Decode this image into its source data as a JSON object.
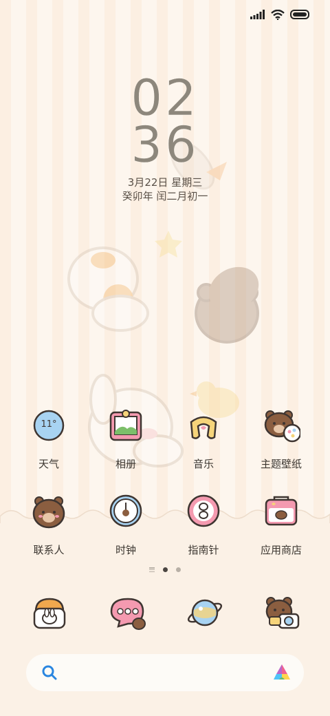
{
  "status_bar": {
    "icons": [
      "signal-icon",
      "wifi-icon",
      "battery-icon"
    ]
  },
  "lock_clock": {
    "hours": "02",
    "minutes": "36",
    "date": "3月22日 星期三",
    "lunar_date": "癸卯年 闰二月初一"
  },
  "apps": [
    {
      "label": "天气",
      "icon": "weather-icon",
      "badge": "11°"
    },
    {
      "label": "相册",
      "icon": "gallery-icon"
    },
    {
      "label": "音乐",
      "icon": "music-icon"
    },
    {
      "label": "主题壁纸",
      "icon": "themes-icon"
    },
    {
      "label": "联系人",
      "icon": "contacts-icon"
    },
    {
      "label": "时钟",
      "icon": "clock-icon"
    },
    {
      "label": "指南针",
      "icon": "compass-icon"
    },
    {
      "label": "应用商店",
      "icon": "app-store-icon"
    }
  ],
  "page_indicator": {
    "pages": 2,
    "active": 1
  },
  "dock": [
    "phone-icon",
    "messages-icon",
    "browser-icon",
    "camera-icon"
  ],
  "search_bar": {
    "icon": "search-icon",
    "assistant_icon": "app-launcher-icon"
  },
  "colors": {
    "background": "#fbf1e6",
    "stripe": "#fcefe2",
    "text": "#3c3731",
    "clock": "#8d877c"
  }
}
